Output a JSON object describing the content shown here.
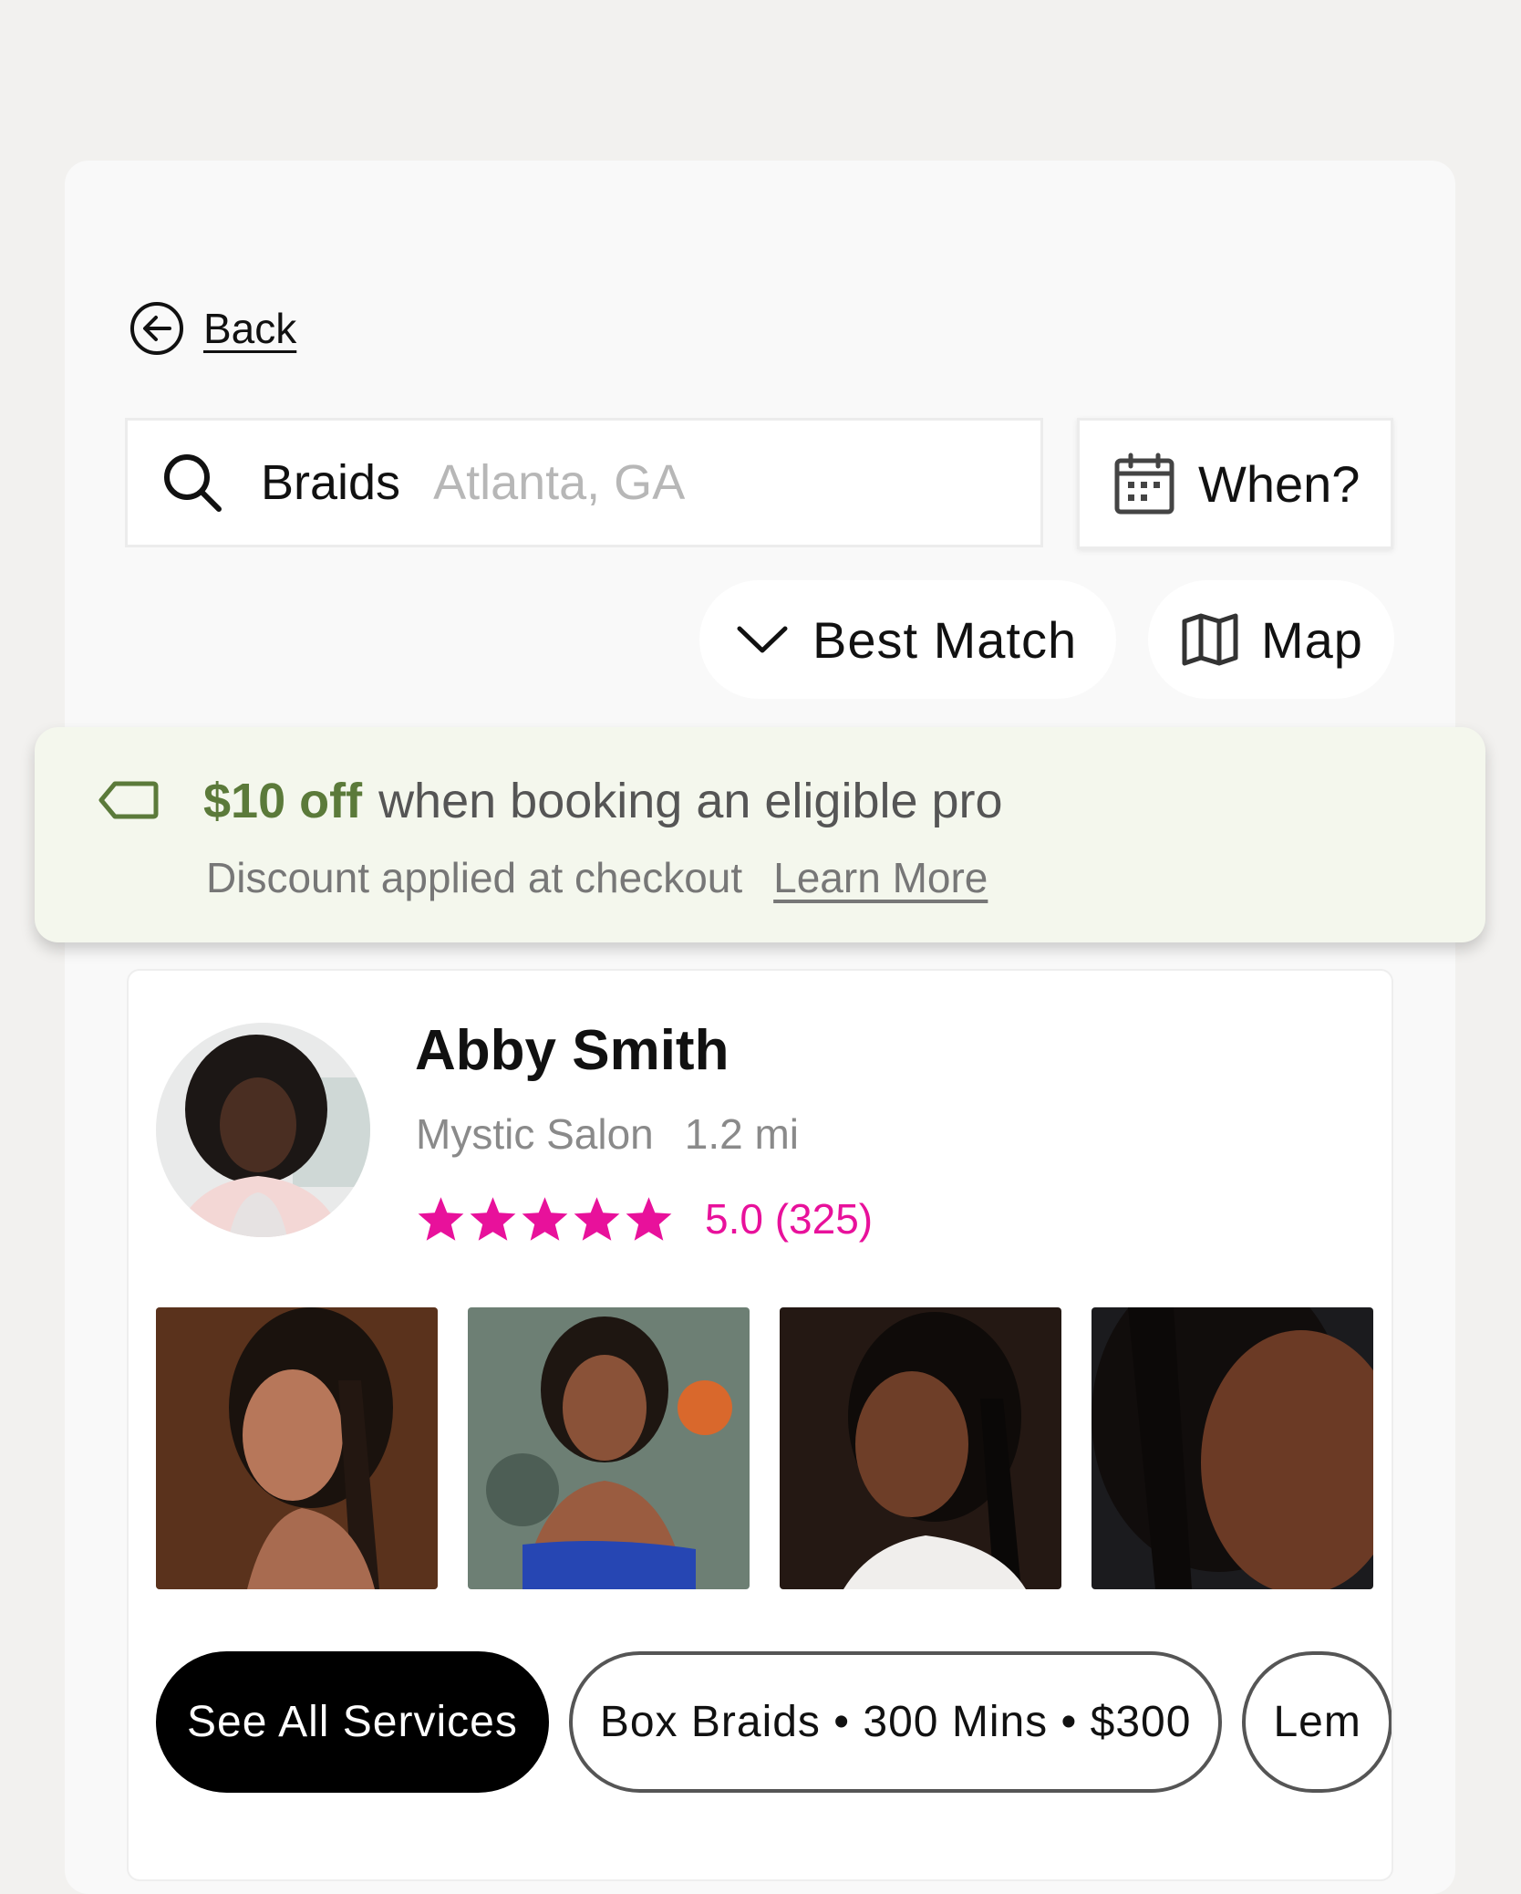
{
  "nav": {
    "back_label": "Back"
  },
  "search": {
    "term": "Braids",
    "location": "Atlanta, GA",
    "when_label": "When?"
  },
  "controls": {
    "sort_label": "Best Match",
    "map_label": "Map"
  },
  "promo": {
    "amount": "$10 off",
    "text": "when booking an eligible pro",
    "note": "Discount applied at checkout",
    "learn_more": "Learn More",
    "accent_color": "#5b7a3a",
    "background_color": "#f4f7ed"
  },
  "pro": {
    "name": "Abby Smith",
    "salon": "Mystic Salon",
    "distance": "1.2 mi",
    "rating": 5.0,
    "rating_text": "5.0 (325)",
    "stars": 5,
    "star_color": "#e8119b"
  },
  "services": [
    {
      "label": "See All Services"
    },
    {
      "label": "Box Braids • 300 Mins • $300"
    },
    {
      "label": "Lem"
    }
  ]
}
